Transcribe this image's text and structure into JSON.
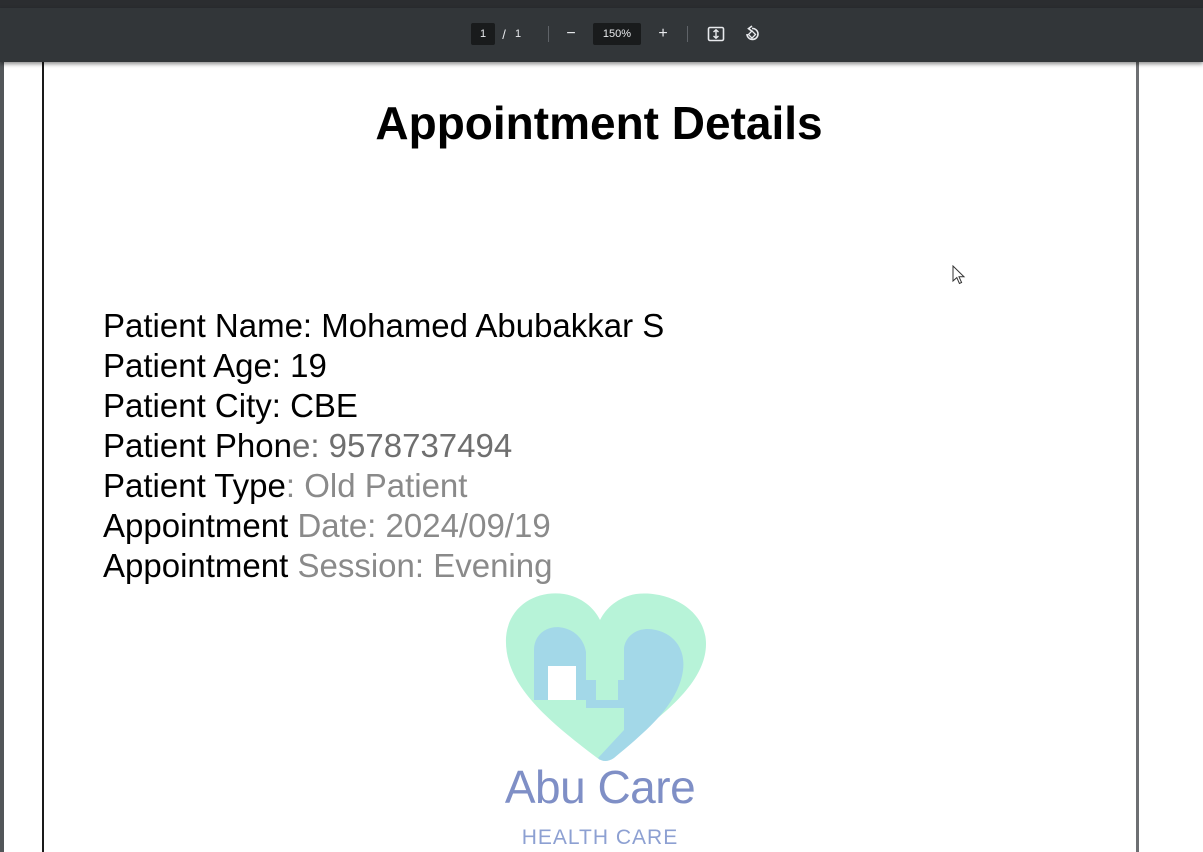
{
  "toolbar": {
    "page_current": "1",
    "page_separator": "/",
    "page_total": "1",
    "zoom_out_label": "−",
    "zoom_level": "150%",
    "zoom_in_label": "+"
  },
  "document": {
    "title": "Appointment Details",
    "fields": [
      {
        "label_a": "Patient Name: Mohamed Abubakkar S",
        "label_b": "",
        "label_c": ""
      },
      {
        "label_a": "Patient Age: 19",
        "label_b": "",
        "label_c": ""
      },
      {
        "label_a": "Patient City: CBE",
        "label_b": "",
        "label_c": ""
      },
      {
        "label_a": "Patient Phon",
        "label_b": "e: 9578737494",
        "label_c": ""
      },
      {
        "label_a": "Patient Type",
        "label_b": ": Old Patient",
        "label_c": ""
      },
      {
        "label_a": "Appointment ",
        "label_b": "Date: 2024/09/19",
        "label_c": ""
      },
      {
        "label_a": "Appointment ",
        "label_b": "Session: Evening",
        "label_c": ""
      }
    ],
    "logo": {
      "brand": "Abu Care",
      "subtitle": "HEALTH CARE",
      "colors": {
        "heart_outer": "#b7f3d8",
        "heart_inner": "#a3d8e8",
        "text": "#7f8fc6"
      }
    }
  }
}
